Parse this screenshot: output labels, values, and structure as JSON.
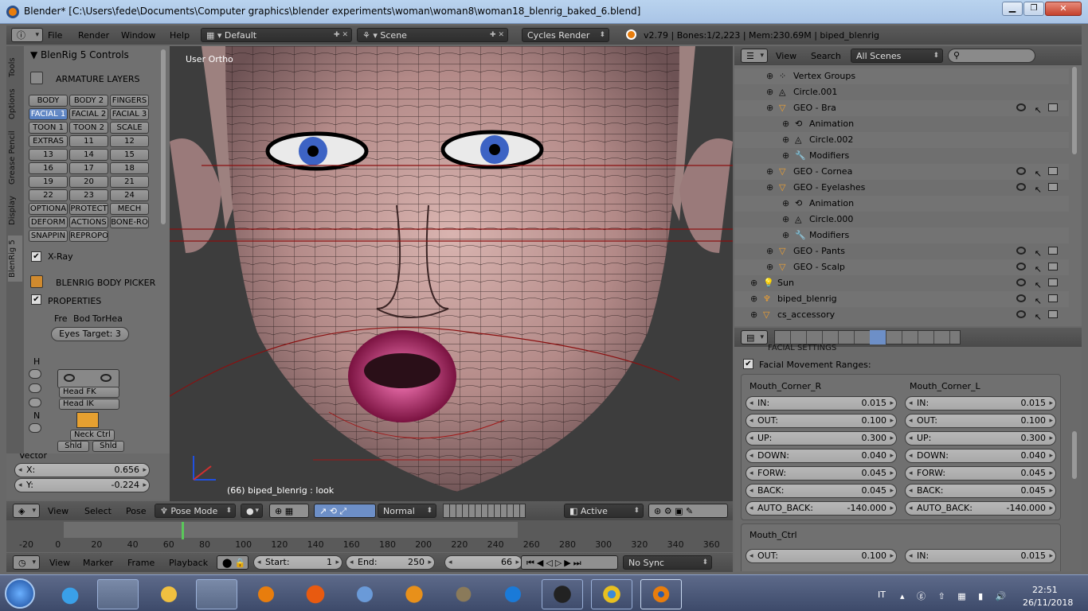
{
  "window": {
    "title": "Blender* [C:\\Users\\fede\\Documents\\Computer graphics\\blender experiments\\woman\\woman8\\woman18_blenrig_baked_6.blend]"
  },
  "topbar": {
    "menus": [
      "File",
      "Render",
      "Window",
      "Help"
    ],
    "layout": "Default",
    "scene": "Scene",
    "engine": "Cycles Render",
    "stats": "v2.79 | Bones:1/2,223 | Mem:230.69M | biped_blenrig"
  },
  "toolshelf": {
    "tabs": [
      "Tools",
      "Options",
      "Grease Pencil",
      "Display",
      "BlenRig 5"
    ],
    "panel_title": "BlenRig 5 Controls",
    "armature_layers": "ARMATURE LAYERS",
    "layer_rows": [
      [
        "BODY",
        "BODY 2",
        "FINGERS"
      ],
      [
        "FACIAL 1",
        "FACIAL 2",
        "FACIAL 3"
      ],
      [
        "TOON 1",
        "TOON 2",
        "SCALE"
      ],
      [
        "EXTRAS",
        "11",
        "12"
      ],
      [
        "13",
        "14",
        "15"
      ],
      [
        "16",
        "17",
        "18"
      ],
      [
        "19",
        "20",
        "21"
      ],
      [
        "22",
        "23",
        "24"
      ],
      [
        "OPTIONA",
        "PROTECT",
        "MECH"
      ],
      [
        "DEFORM",
        "ACTIONS",
        "BONE-RO"
      ],
      [
        "SNAPPIN",
        "REPROPO",
        ""
      ]
    ],
    "xray": "X-Ray",
    "body_picker": "BLENRIG BODY PICKER",
    "properties": "PROPERTIES",
    "tabs_small": [
      "Fre",
      "Bod",
      "TorHea"
    ],
    "eyes_target": "Eyes Target:  3",
    "picker": {
      "h": "H",
      "n": "N",
      "head_fk": "Head FK",
      "head_ik": "Head IK",
      "neck": "Neck Ctrl",
      "shld_l": "Shld",
      "shld_r": "Shld"
    },
    "vector": {
      "title": "Vector",
      "x_label": "X:",
      "x": "0.656",
      "y_label": "Y:",
      "y": "-0.224"
    }
  },
  "viewport": {
    "label": "User Ortho",
    "status": "(66) biped_blenrig : look"
  },
  "viewport_header": {
    "menus": [
      "View",
      "Select",
      "Pose"
    ],
    "mode": "Pose Mode",
    "orient": "Normal",
    "pivot": "Active"
  },
  "timeline": {
    "ticks": [
      "-20",
      "0",
      "20",
      "40",
      "60",
      "80",
      "100",
      "120",
      "140",
      "160",
      "180",
      "200",
      "220",
      "240",
      "260",
      "280",
      "300",
      "320",
      "340",
      "360"
    ],
    "menus": [
      "View",
      "Marker",
      "Frame",
      "Playback"
    ],
    "start": "Start:",
    "start_v": "1",
    "end": "End:",
    "end_v": "250",
    "frame": "66",
    "sync": "No Sync"
  },
  "outliner": {
    "menus": [
      "View",
      "Search"
    ],
    "filter": "All Scenes",
    "rows": [
      {
        "indent": 1,
        "name": "Vertex Groups",
        "type": "vg"
      },
      {
        "indent": 1,
        "name": "Circle.001",
        "type": "mesh"
      },
      {
        "indent": 1,
        "name": "GEO - Bra",
        "type": "obj",
        "vis": true
      },
      {
        "indent": 2,
        "name": "Animation",
        "type": "anim"
      },
      {
        "indent": 2,
        "name": "Circle.002",
        "type": "mesh"
      },
      {
        "indent": 2,
        "name": "Modifiers",
        "type": "mod"
      },
      {
        "indent": 1,
        "name": "GEO - Cornea",
        "type": "obj",
        "vis": true
      },
      {
        "indent": 1,
        "name": "GEO - Eyelashes",
        "type": "obj",
        "vis": true
      },
      {
        "indent": 2,
        "name": "Animation",
        "type": "anim"
      },
      {
        "indent": 2,
        "name": "Circle.000",
        "type": "mesh"
      },
      {
        "indent": 2,
        "name": "Modifiers",
        "type": "mod"
      },
      {
        "indent": 1,
        "name": "GEO - Pants",
        "type": "obj",
        "vis": true
      },
      {
        "indent": 1,
        "name": "GEO - Scalp",
        "type": "obj",
        "vis": true
      },
      {
        "indent": 0,
        "name": "Sun",
        "type": "lamp",
        "vis": true
      },
      {
        "indent": 0,
        "name": "biped_blenrig",
        "type": "arm",
        "vis": true
      },
      {
        "indent": 0,
        "name": "cs_accessory",
        "type": "obj",
        "vis": true
      }
    ]
  },
  "properties": {
    "cut_title": "FACIAL SETTINGS",
    "panel": "Facial Movement Ranges:",
    "left_title": "Mouth_Corner_R",
    "right_title": "Mouth_Corner_L",
    "left": [
      [
        "IN:",
        "0.015"
      ],
      [
        "OUT:",
        "0.100"
      ],
      [
        "UP:",
        "0.300"
      ],
      [
        "DOWN:",
        "0.040"
      ],
      [
        "FORW:",
        "0.045"
      ],
      [
        "BACK:",
        "0.045"
      ],
      [
        "AUTO_BACK:",
        "-140.000"
      ]
    ],
    "right": [
      [
        "IN:",
        "0.015"
      ],
      [
        "OUT:",
        "0.100"
      ],
      [
        "UP:",
        "0.300"
      ],
      [
        "DOWN:",
        "0.040"
      ],
      [
        "FORW:",
        "0.045"
      ],
      [
        "BACK:",
        "0.045"
      ],
      [
        "AUTO_BACK:",
        "-140.000"
      ]
    ],
    "mouth_ctrl": "Mouth_Ctrl",
    "mc_left": [
      "OUT:",
      "0.100"
    ],
    "mc_right": [
      "IN:",
      "0.015"
    ]
  },
  "taskbar": {
    "lang": "IT",
    "time": "22:51",
    "date": "26/11/2018"
  }
}
